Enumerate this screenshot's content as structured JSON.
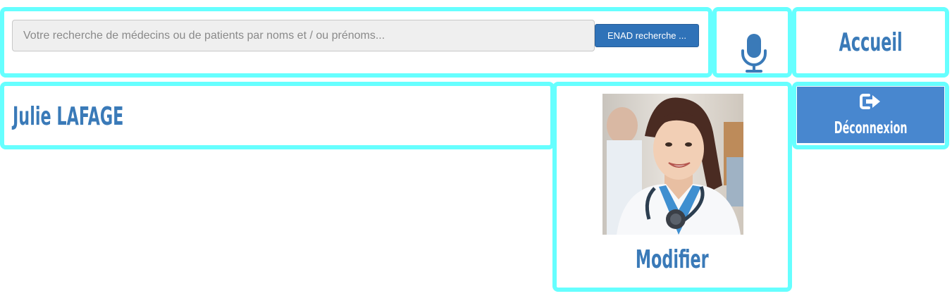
{
  "search": {
    "placeholder": "Votre recherche de médecins ou de patients par noms et / ou prénoms...",
    "button_label": "ENAD recherche ..."
  },
  "icons": {
    "microphone": "microphone-icon",
    "logout": "logout-icon",
    "avatar": "doctor-photo"
  },
  "nav": {
    "home_label": "Accueil",
    "logout_label": "Déconnexion"
  },
  "user": {
    "name": "Julie LAFAGE",
    "modify_label": "Modifier"
  },
  "colors": {
    "accent_border": "#66ffff",
    "heading_blue": "#3a7ab8",
    "button_blue": "#2f72b8",
    "logout_blue": "#4887cf"
  }
}
